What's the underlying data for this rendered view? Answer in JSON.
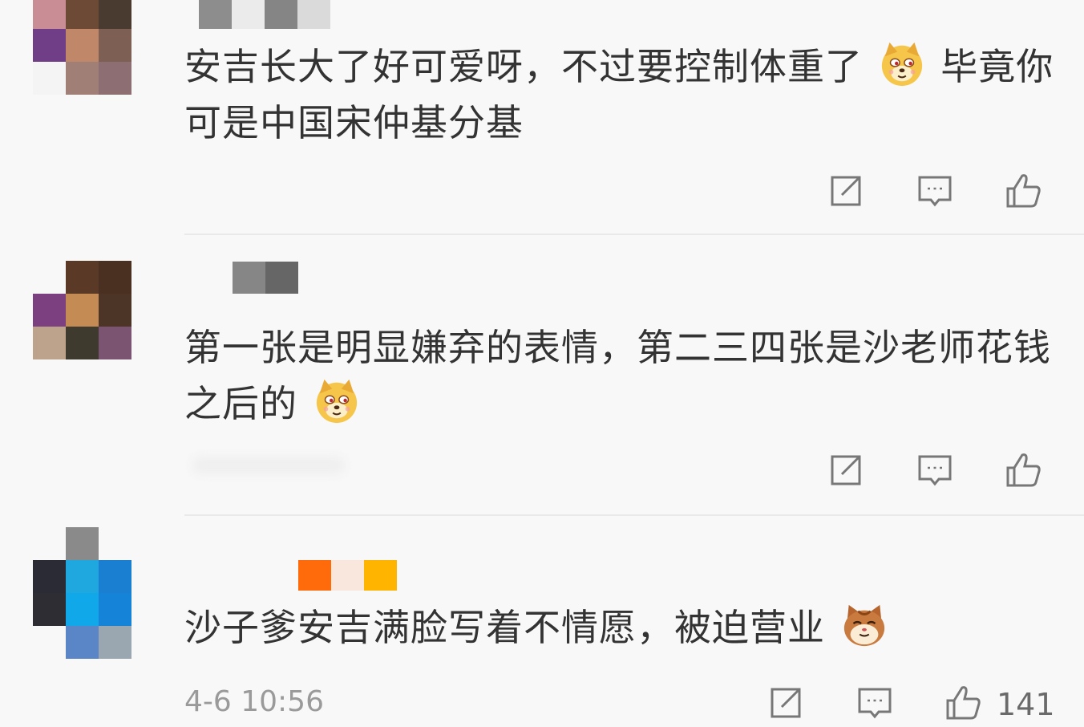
{
  "colors": {
    "background": "#f8f8f8",
    "text": "#333333",
    "meta": "#9a9a9a",
    "icon": "#777777"
  },
  "comments": [
    {
      "text_before_emoji": "安吉长大了好可爱呀，不过要控制体重了",
      "emoji": "doge-emoji",
      "text_after_emoji": "毕竟你可是中国宋仲基分基",
      "avatar_mosaic": [
        "#c98d96",
        "#6c4a35",
        "#4a3b31",
        "#6f3e86",
        "#c08769",
        "#7d5f53",
        "#f4f4f4",
        "#a07f76",
        "#8d6e72"
      ],
      "name_mosaic": [
        "#8d8d8d",
        "#ebebeb",
        "#858585",
        "#dadada"
      ]
    },
    {
      "text_before_emoji": "第一张是明显嫌弃的表情，第二三四张是沙老师花钱之后的",
      "emoji": "doge-emoji",
      "text_after_emoji": "",
      "avatar_mosaic": [
        "#f8f8f8",
        "#5a3a26",
        "#4a3020",
        "#7c3f80",
        "#c48b55",
        "#4c3426",
        "#bda28c",
        "#3f3a2e",
        "#7a5470"
      ],
      "name_mosaic": [
        "#868686",
        "#666666"
      ]
    },
    {
      "text_before_emoji": "沙子爹安吉满脸写着不情愿，被迫营业",
      "emoji": "cat-emoji",
      "text_after_emoji": "",
      "time": "4-6 10:56",
      "likes": "141",
      "avatar_mosaic": [
        "#f8f8f8",
        "#8a8a8a",
        "#f8f8f8",
        "#2b2b35",
        "#1fa7e0",
        "#1a7fd0",
        "#2d2d33",
        "#10a8e8",
        "#1584d8",
        "#f8f8f8",
        "#5a86c8",
        "#9aa6b0"
      ],
      "name_mosaic": [
        "#ff6a0a",
        "#f9e6dd",
        "#ffb400"
      ]
    }
  ]
}
